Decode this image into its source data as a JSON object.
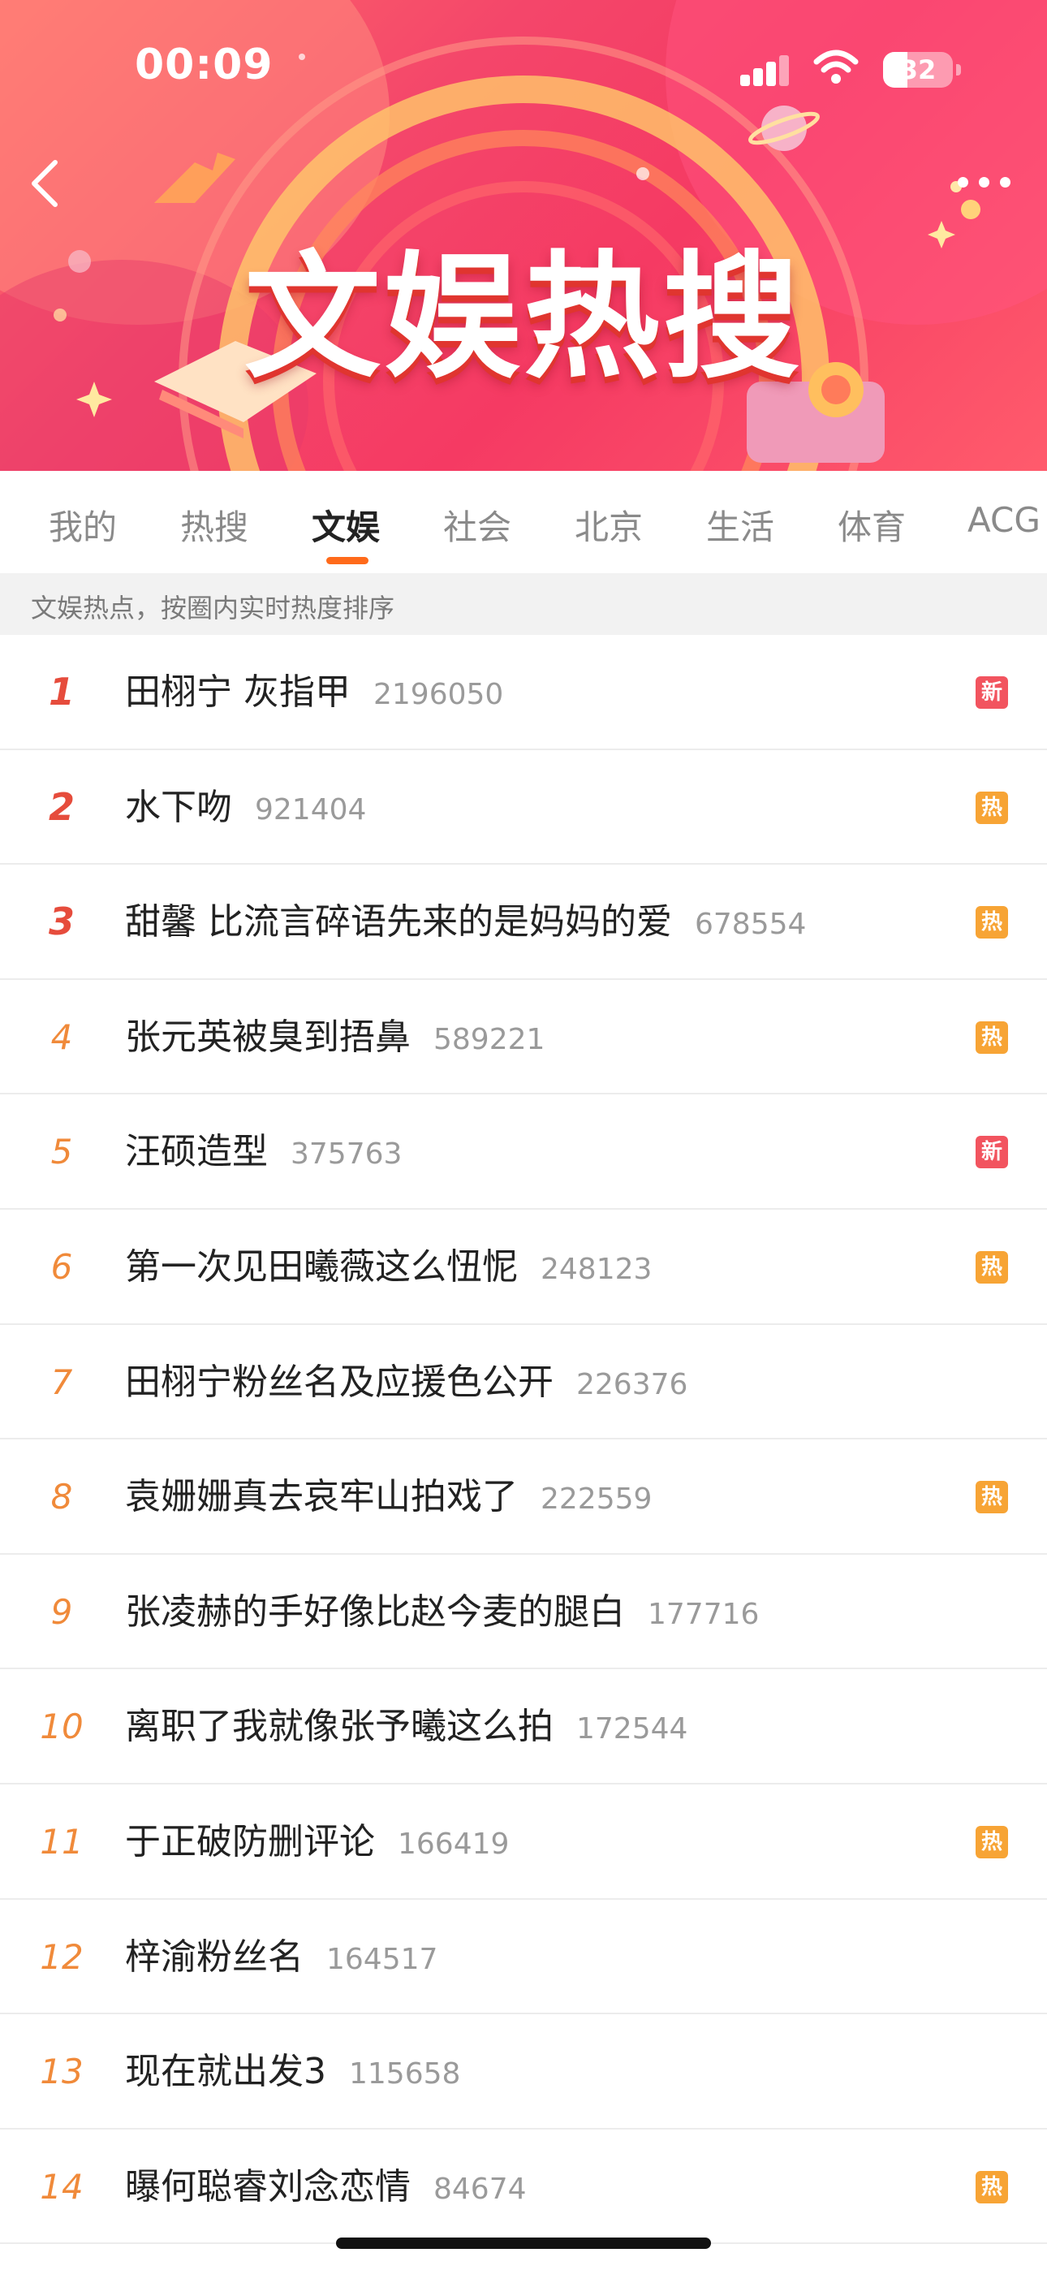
{
  "status_bar": {
    "time": "00:09",
    "battery": "32"
  },
  "banner": {
    "title": "文娱热搜"
  },
  "tabs": [
    {
      "label": "我的"
    },
    {
      "label": "热搜"
    },
    {
      "label": "文娱"
    },
    {
      "label": "社会"
    },
    {
      "label": "北京"
    },
    {
      "label": "生活"
    },
    {
      "label": "体育"
    },
    {
      "label": "ACG"
    }
  ],
  "active_tab": "文娱",
  "subheader": "文娱热点，按圈内实时热度排序",
  "badges": {
    "new": "新",
    "hot": "热"
  },
  "colors": {
    "accent": "#ff6a1a",
    "new_badge": "#f2545f",
    "hot_badge": "#f7a435",
    "rank_top": "#e64c3c",
    "rank": "#f08a3a"
  },
  "list": [
    {
      "rank": "1",
      "title": "田栩宁 灰指甲",
      "count": "2196050",
      "badge": "新"
    },
    {
      "rank": "2",
      "title": "水下吻",
      "count": "921404",
      "badge": "热"
    },
    {
      "rank": "3",
      "title": "甜馨 比流言碎语先来的是妈妈的爱",
      "count": "678554",
      "badge": "热"
    },
    {
      "rank": "4",
      "title": "张元英被臭到捂鼻",
      "count": "589221",
      "badge": "热"
    },
    {
      "rank": "5",
      "title": "汪硕造型",
      "count": "375763",
      "badge": "新"
    },
    {
      "rank": "6",
      "title": "第一次见田曦薇这么忸怩",
      "count": "248123",
      "badge": "热"
    },
    {
      "rank": "7",
      "title": "田栩宁粉丝名及应援色公开",
      "count": "226376",
      "badge": ""
    },
    {
      "rank": "8",
      "title": "袁姗姗真去哀牢山拍戏了",
      "count": "222559",
      "badge": "热"
    },
    {
      "rank": "9",
      "title": "张凌赫的手好像比赵今麦的腿白",
      "count": "177716",
      "badge": ""
    },
    {
      "rank": "10",
      "title": "离职了我就像张予曦这么拍",
      "count": "172544",
      "badge": ""
    },
    {
      "rank": "11",
      "title": "于正破防删评论",
      "count": "166419",
      "badge": "热"
    },
    {
      "rank": "12",
      "title": "梓渝粉丝名",
      "count": "164517",
      "badge": ""
    },
    {
      "rank": "13",
      "title": "现在就出发3",
      "count": "115658",
      "badge": ""
    },
    {
      "rank": "14",
      "title": "曝何聪睿刘念恋情",
      "count": "84674",
      "badge": "热"
    }
  ]
}
